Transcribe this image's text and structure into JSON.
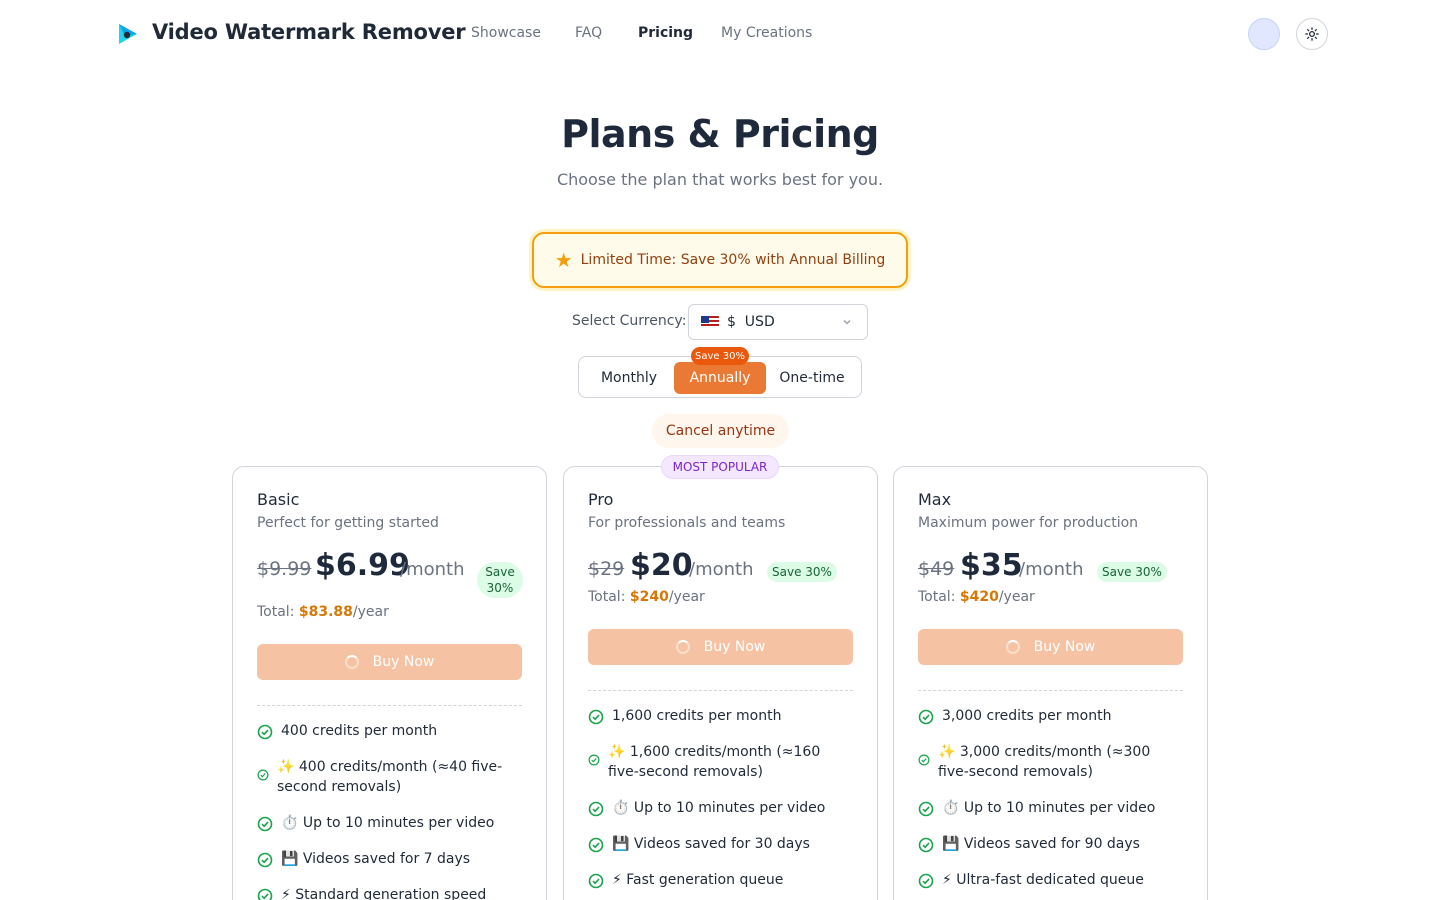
{
  "header": {
    "brand": "Video Watermark Remover",
    "logo_icon": "play-logo-icon",
    "nav": [
      {
        "label": "Showcase"
      },
      {
        "label": "FAQ"
      },
      {
        "label": "Pricing",
        "active": true
      },
      {
        "label": "My Creations"
      }
    ],
    "theme_icon": "sun-icon"
  },
  "hero": {
    "title": "Plans & Pricing",
    "subtitle": "Choose the plan that works best for you."
  },
  "promo": {
    "icon": "star-icon",
    "text": "Limited Time: Save 30% with Annual Billing"
  },
  "currency": {
    "label": "Select Currency:",
    "selected": "$  USD"
  },
  "billing": {
    "options": [
      "Monthly",
      "Annually",
      "One-time"
    ],
    "selected": "Annually",
    "save_pill": "Save 30%",
    "cancel_note": "Cancel anytime"
  },
  "plans": [
    {
      "name": "Basic",
      "desc": "Perfect for getting started",
      "old_price": "$9.99",
      "price": "$6.99",
      "per": "/month",
      "save_badge": "Save 30%",
      "total_label": "Total:",
      "total_value": "$83.88",
      "total_suffix": "/year",
      "button": "Buy Now",
      "features": [
        "400 credits per month",
        "✨ 400 credits/month (≈40 five-second removals)",
        "⏱️ Up to 10 minutes per video",
        "💾 Videos saved for 7 days",
        "⚡ Standard generation speed"
      ]
    },
    {
      "name": "Pro",
      "desc": "For professionals and teams",
      "badge": "MOST POPULAR",
      "old_price": "$29",
      "price": "$20",
      "per": "/month",
      "save_badge": "Save 30%",
      "total_label": "Total:",
      "total_value": "$240",
      "total_suffix": "/year",
      "button": "Buy Now",
      "features": [
        "1,600 credits per month",
        "✨ 1,600 credits/month (≈160 five-second removals)",
        "⏱️ Up to 10 minutes per video",
        "💾 Videos saved for 30 days",
        "⚡ Fast generation queue"
      ]
    },
    {
      "name": "Max",
      "desc": "Maximum power for production",
      "old_price": "$49",
      "price": "$35",
      "per": "/month",
      "save_badge": "Save 30%",
      "total_label": "Total:",
      "total_value": "$420",
      "total_suffix": "/year",
      "button": "Buy Now",
      "features": [
        "3,000 credits per month",
        "✨ 3,000 credits/month (≈300 five-second removals)",
        "⏱️ Up to 10 minutes per video",
        "💾 Videos saved for 90 days",
        "⚡ Ultra-fast dedicated queue"
      ]
    }
  ]
}
